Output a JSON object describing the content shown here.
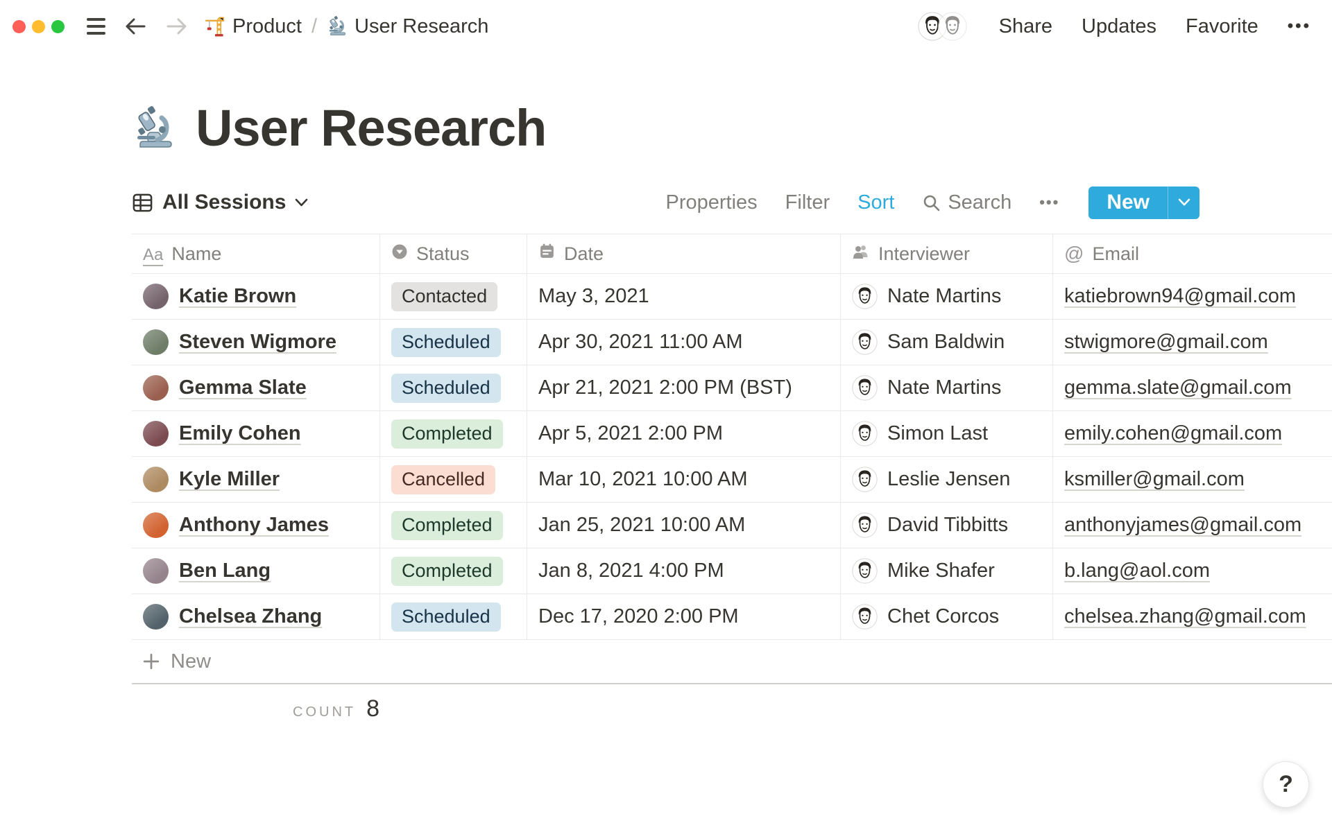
{
  "topbar": {
    "breadcrumb": {
      "section_icon": "crane-icon",
      "section": "Product",
      "separator": "/",
      "page_icon": "microscope-icon",
      "page": "User Research"
    },
    "actions": {
      "share": "Share",
      "updates": "Updates",
      "favorite": "Favorite",
      "more": "•••"
    },
    "avatar_count": 2
  },
  "page": {
    "icon": "microscope-icon",
    "title": "User Research"
  },
  "view_bar": {
    "view_label": "All Sessions",
    "properties": "Properties",
    "filter": "Filter",
    "sort": "Sort",
    "search": "Search",
    "more": "•••",
    "new_label": "New",
    "sort_active_color": "#2EAADC",
    "new_button_color": "#2EAADC"
  },
  "table": {
    "columns": [
      {
        "label": "Name",
        "icon": "text"
      },
      {
        "label": "Status",
        "icon": "select"
      },
      {
        "label": "Date",
        "icon": "calendar"
      },
      {
        "label": "Interviewer",
        "icon": "people"
      },
      {
        "label": "Email",
        "icon": "at"
      }
    ],
    "rows": [
      {
        "name": "Katie Brown",
        "avatar_color": "#75636B",
        "status": "Contacted",
        "date": "May 3, 2021",
        "interviewer": "Nate Martins",
        "email": "katiebrown94@gmail.com"
      },
      {
        "name": "Steven Wigmore",
        "avatar_color": "#6E7D68",
        "status": "Scheduled",
        "date": "Apr 30, 2021 11:00 AM",
        "interviewer": "Sam Baldwin",
        "email": "stwigmore@gmail.com"
      },
      {
        "name": "Gemma Slate",
        "avatar_color": "#9A5F4E",
        "status": "Scheduled",
        "date": "Apr 21, 2021 2:00 PM (BST)",
        "interviewer": "Nate Martins",
        "email": "gemma.slate@gmail.com"
      },
      {
        "name": "Emily Cohen",
        "avatar_color": "#7C4B50",
        "status": "Completed",
        "date": "Apr 5, 2021 2:00 PM",
        "interviewer": "Simon Last",
        "email": "emily.cohen@gmail.com"
      },
      {
        "name": "Kyle Miller",
        "avatar_color": "#AE8A60",
        "status": "Cancelled",
        "date": "Mar 10, 2021 10:00 AM",
        "interviewer": "Leslie Jensen",
        "email": "ksmiller@gmail.com"
      },
      {
        "name": "Anthony James",
        "avatar_color": "#D2622F",
        "status": "Completed",
        "date": "Jan 25, 2021 10:00 AM",
        "interviewer": "David Tibbitts",
        "email": "anthonyjames@gmail.com"
      },
      {
        "name": "Ben Lang",
        "avatar_color": "#95838C",
        "status": "Completed",
        "date": "Jan 8, 2021 4:00 PM",
        "interviewer": "Mike Shafer",
        "email": "b.lang@aol.com"
      },
      {
        "name": "Chelsea Zhang",
        "avatar_color": "#53626A",
        "status": "Scheduled",
        "date": "Dec 17, 2020 2:00 PM",
        "interviewer": "Chet Corcos",
        "email": "chelsea.zhang@gmail.com"
      }
    ],
    "new_row_label": "New",
    "footer": {
      "count_label": "COUNT",
      "count_value": "8"
    }
  },
  "status_styles": {
    "Contacted": {
      "bg": "#E3E2E0",
      "text": "#32302C"
    },
    "Scheduled": {
      "bg": "#D3E5EF",
      "text": "#183347"
    },
    "Completed": {
      "bg": "#DBEDDB",
      "text": "#1C3829"
    },
    "Cancelled": {
      "bg": "#FBDDD2",
      "text": "#442A22"
    }
  },
  "help_button": {
    "label": "?"
  }
}
